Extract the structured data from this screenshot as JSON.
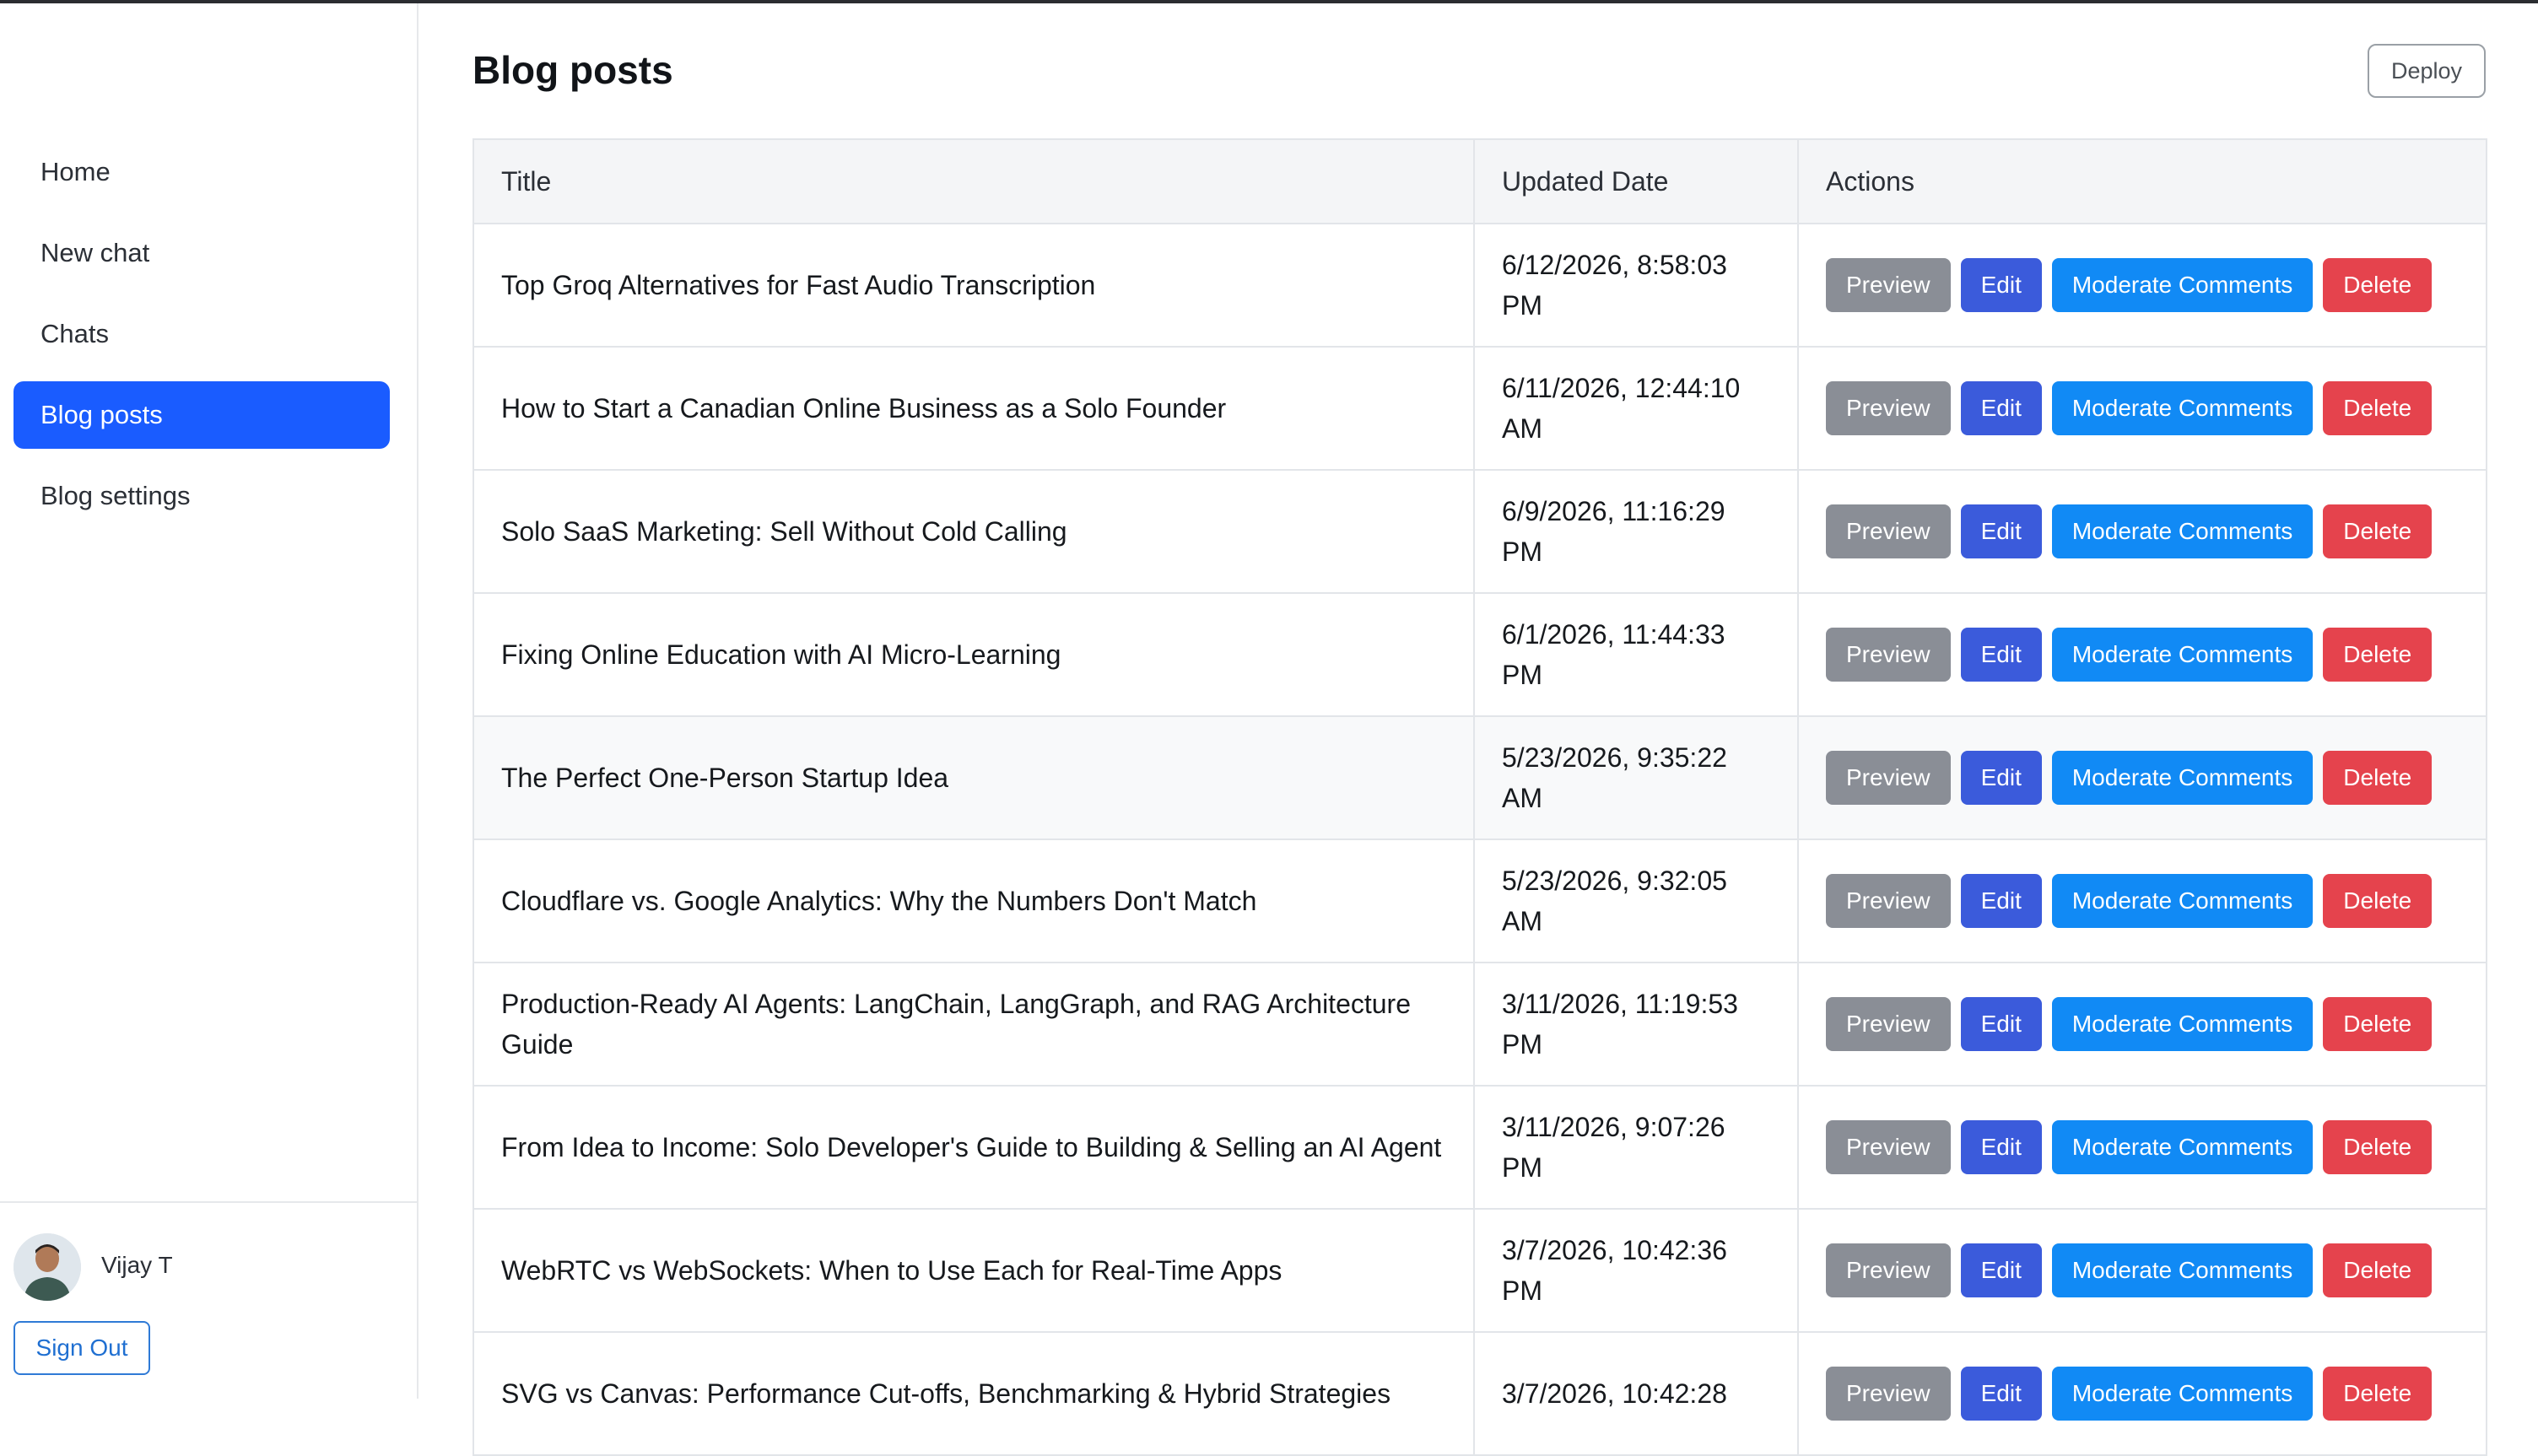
{
  "sidebar": {
    "items": [
      {
        "label": "Home"
      },
      {
        "label": "New chat"
      },
      {
        "label": "Chats"
      },
      {
        "label": "Blog posts"
      },
      {
        "label": "Blog settings"
      }
    ],
    "active_index": 3,
    "user": {
      "name": "Vijay T",
      "sign_out_label": "Sign Out"
    }
  },
  "header": {
    "title": "Blog posts",
    "deploy_label": "Deploy"
  },
  "table": {
    "columns": [
      "Title",
      "Updated Date",
      "Actions"
    ],
    "action_labels": {
      "preview": "Preview",
      "edit": "Edit",
      "moderate": "Moderate Comments",
      "delete": "Delete"
    },
    "rows": [
      {
        "title": "Top Groq Alternatives for Fast Audio Transcription",
        "updated": "6/12/2026, 8:58:03 PM"
      },
      {
        "title": "How to Start a Canadian Online Business as a Solo Founder",
        "updated": "6/11/2026, 12:44:10 AM"
      },
      {
        "title": "Solo SaaS Marketing: Sell Without Cold Calling",
        "updated": "6/9/2026, 11:16:29 PM"
      },
      {
        "title": "Fixing Online Education with AI Micro-Learning",
        "updated": "6/1/2026, 11:44:33 PM"
      },
      {
        "title": "The Perfect One-Person Startup Idea",
        "updated": "5/23/2026, 9:35:22 AM"
      },
      {
        "title": "Cloudflare vs. Google Analytics: Why the Numbers Don't Match",
        "updated": "5/23/2026, 9:32:05 AM"
      },
      {
        "title": "Production-Ready AI Agents: LangChain, LangGraph, and RAG Architecture Guide",
        "updated": "3/11/2026, 11:19:53 PM"
      },
      {
        "title": "From Idea to Income: Solo Developer's Guide to Building & Selling an AI Agent",
        "updated": "3/11/2026, 9:07:26 PM"
      },
      {
        "title": "WebRTC vs WebSockets: When to Use Each for Real-Time Apps",
        "updated": "3/7/2026, 10:42:36 PM"
      },
      {
        "title": "SVG vs Canvas: Performance Cut-offs, Benchmarking & Hybrid Strategies",
        "updated": "3/7/2026, 10:42:28"
      }
    ]
  },
  "colors": {
    "accent": "#1a5cff",
    "preview": "#8a8e96",
    "edit": "#3b5bdb",
    "moderate": "#118af5",
    "delete": "#e5434d"
  }
}
